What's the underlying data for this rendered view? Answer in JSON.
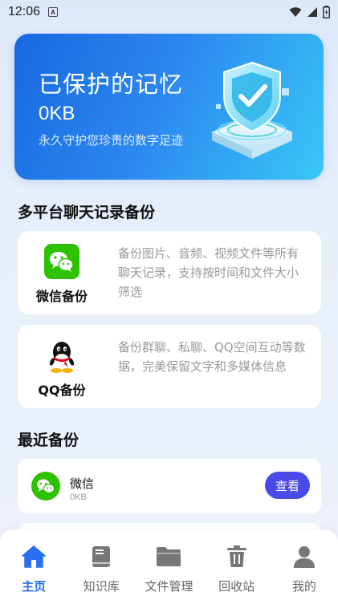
{
  "status_bar": {
    "time": "12:06",
    "notification_letter": "A"
  },
  "hero": {
    "title": "已保护的记忆",
    "size": "0KB",
    "subtitle": "永久守护您珍贵的数字足迹"
  },
  "platform_section": {
    "title": "多平台聊天记录备份",
    "items": [
      {
        "name": "微信备份",
        "description": "备份图片、音频、视频文件等所有聊天记录，支持按时间和文件大小筛选",
        "icon": "wechat-icon"
      },
      {
        "name": "QQ备份",
        "description": "备份群聊、私聊、QQ空间互动等数据，完美保留文字和多媒体信息",
        "icon": "qq-icon"
      }
    ]
  },
  "recent_section": {
    "title": "最近备份",
    "items": [
      {
        "name": "微信",
        "size": "0KB",
        "button": "查看",
        "icon": "wechat-icon"
      }
    ]
  },
  "bottom_nav": {
    "items": [
      {
        "label": "主页",
        "icon": "home-icon",
        "active": true
      },
      {
        "label": "知识库",
        "icon": "book-icon",
        "active": false
      },
      {
        "label": "文件管理",
        "icon": "folder-icon",
        "active": false
      },
      {
        "label": "回收站",
        "icon": "trash-icon",
        "active": false
      },
      {
        "label": "我的",
        "icon": "user-icon",
        "active": false
      }
    ]
  },
  "colors": {
    "accent": "#2a6ff0",
    "button": "#4a4ae8",
    "wechat_green": "#2dc100",
    "hero_start": "#1769e0",
    "hero_end": "#38c8f5"
  }
}
